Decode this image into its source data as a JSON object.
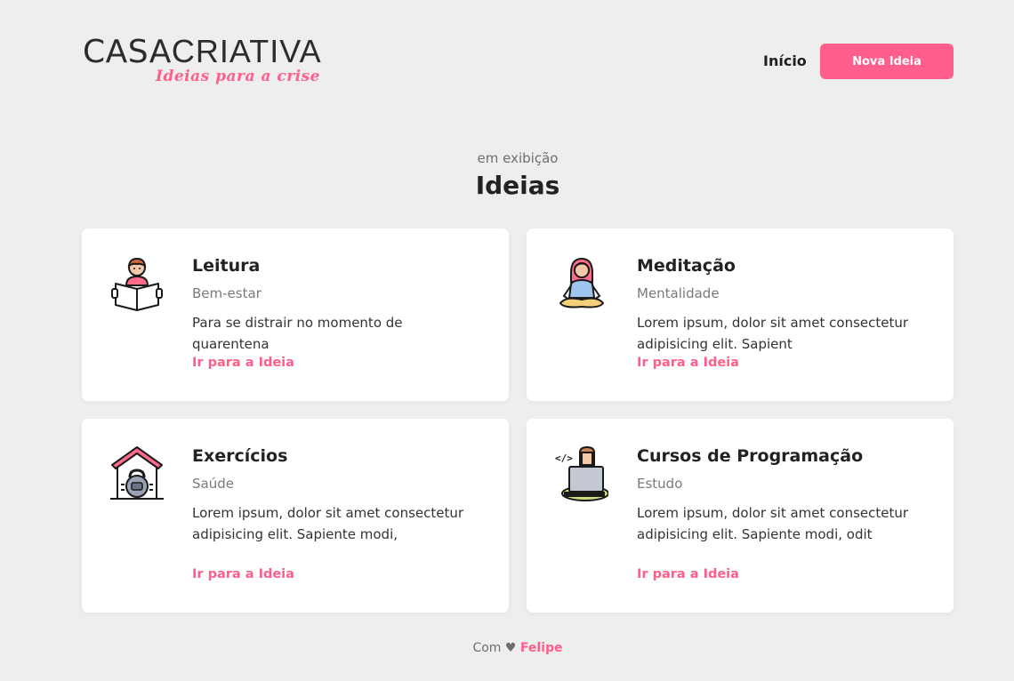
{
  "header": {
    "logo_main_bold": "CASA",
    "logo_main_light": "CRIATIVA",
    "logo_tagline": "Ideias para a crise",
    "nav_home": "Início",
    "nav_button": "Nova Ideia"
  },
  "section": {
    "subtitle": "em exibição",
    "title": "Ideias"
  },
  "cards": [
    {
      "icon": "reading-person-icon",
      "title": "Leitura",
      "category": "Bem-estar",
      "description": "Para se distrair no momento de quarentena",
      "link": "Ir para a Ideia"
    },
    {
      "icon": "meditation-person-icon",
      "title": "Meditação",
      "category": "Mentalidade",
      "description": "Lorem ipsum, dolor sit amet consectetur adipisicing elit. Sapient",
      "link": "Ir para a Ideia"
    },
    {
      "icon": "home-workout-icon",
      "title": "Exercícios",
      "category": "Saúde",
      "description": "Lorem ipsum, dolor sit amet consectetur adipisicing elit. Sapiente modi,",
      "link": "Ir para a Ideia"
    },
    {
      "icon": "programmer-icon",
      "title": "Cursos de Programação",
      "category": "Estudo",
      "description": "Lorem ipsum, dolor sit amet consectetur adipisicing elit. Sapiente modi, odit",
      "link": "Ir para a Ideia"
    }
  ],
  "footer": {
    "prefix": "Com",
    "heart": "♥",
    "author": "Felipe"
  },
  "colors": {
    "accent": "#ff5f8a",
    "background": "#eeeeee",
    "card": "#ffffff"
  }
}
